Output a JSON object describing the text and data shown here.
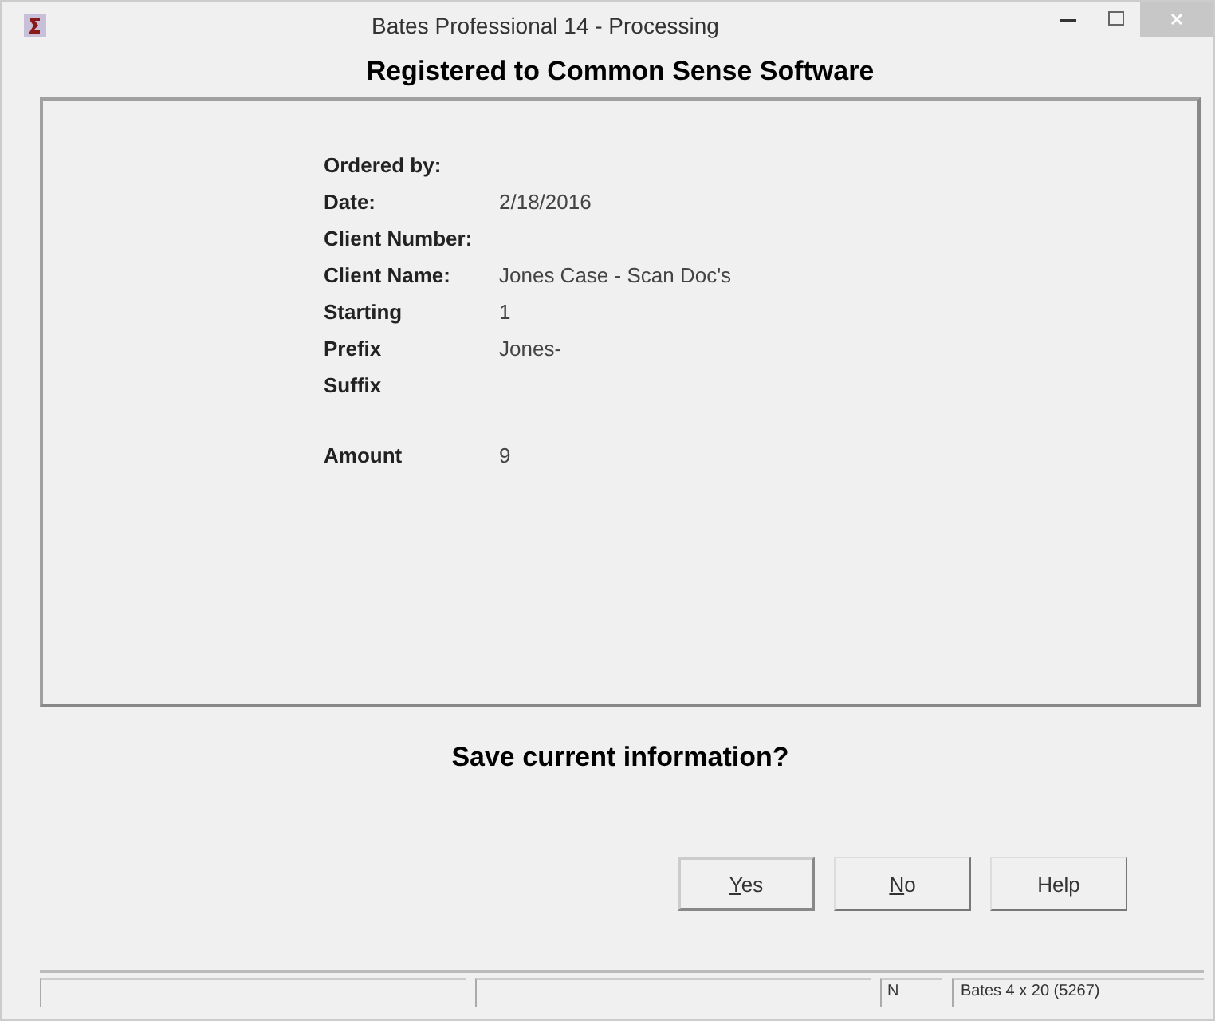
{
  "window": {
    "title": "Bates Professional 14 - Processing"
  },
  "heading": "Registered to Common Sense Software",
  "fields": [
    {
      "label": "Ordered by:"
    },
    {
      "label": "Date:",
      "value": "2/18/2016"
    },
    {
      "label": "Client Number:"
    },
    {
      "label": "Client Name:",
      "value": "Jones Case - Scan Doc's"
    },
    {
      "label": "Starting",
      "value": "1"
    },
    {
      "label": "Prefix",
      "value": "Jones-"
    },
    {
      "label": "Suffix"
    }
  ],
  "totals": [
    {
      "label": "Amount",
      "value": "9"
    }
  ],
  "question": "Save current information?",
  "buttons": [
    {
      "label": "Yes",
      "mnemonic": true,
      "default": true
    },
    {
      "label": "No",
      "mnemonic": true,
      "default": false
    },
    {
      "label": "Help",
      "mnemonic": false,
      "default": false
    }
  ],
  "status_bar": {
    "panes": [
      {
        "kind": "blank"
      },
      {
        "kind": "blank"
      },
      {
        "kind": "text",
        "text": "N"
      },
      {
        "kind": "text",
        "text": "Bates 4 x 20 (5267)"
      }
    ]
  }
}
